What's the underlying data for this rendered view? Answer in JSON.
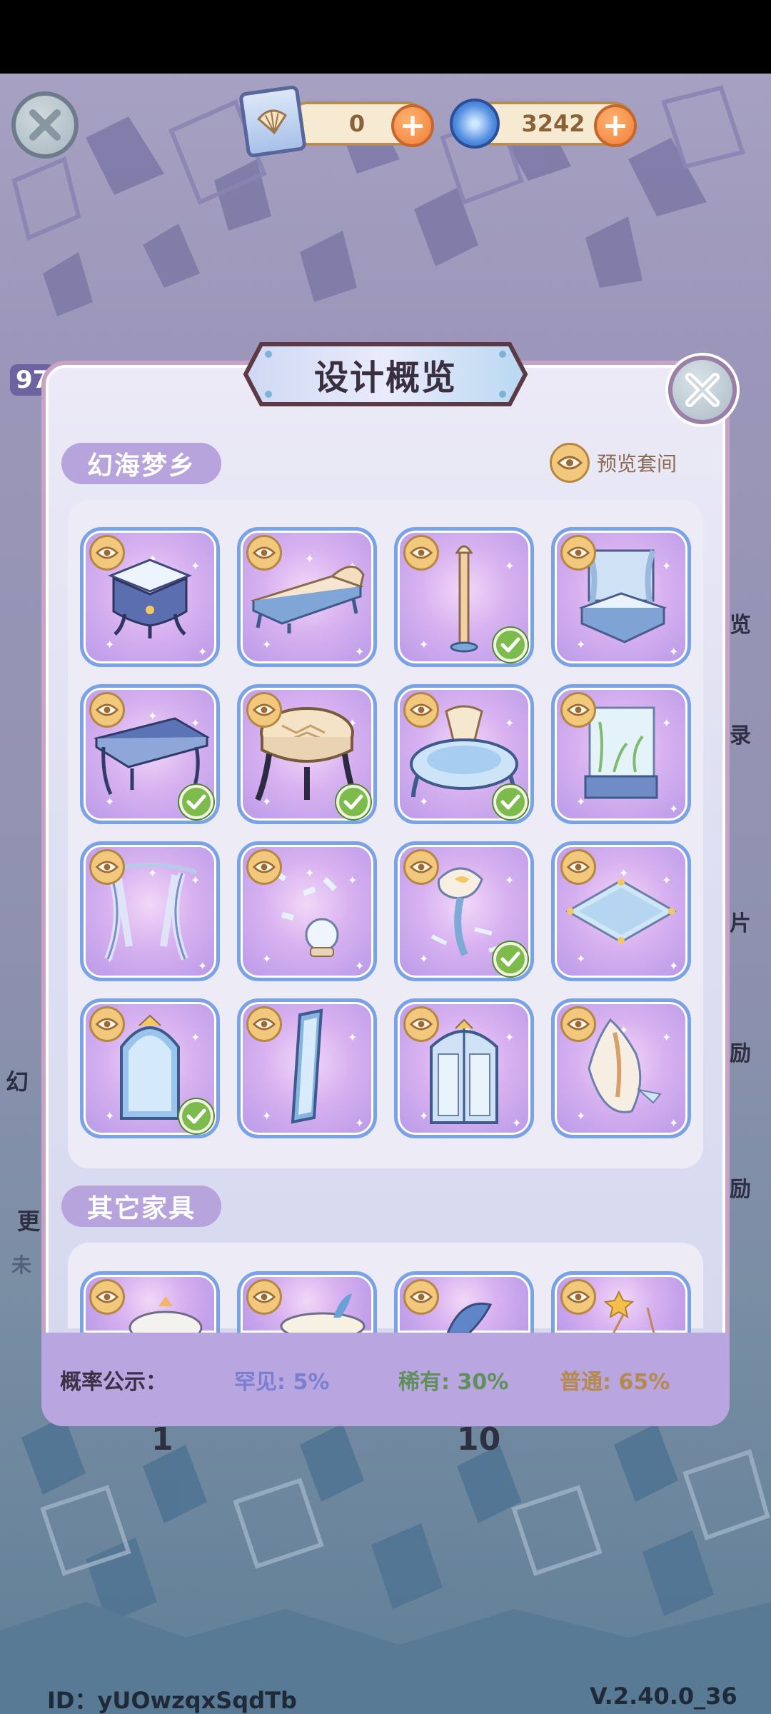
{
  "hud": {
    "coupon_count": "0",
    "swirl_count": "3242",
    "plus": "+"
  },
  "behind": {
    "left_number": "97",
    "side_texts": [
      "览",
      "录",
      "片",
      "励",
      "励"
    ],
    "left_texts": [
      "幻",
      "更",
      "未"
    ],
    "button_counts": [
      "1",
      "10"
    ]
  },
  "panel": {
    "title": "设计概览",
    "section1": "幻海梦乡",
    "preview_suite": "预览套间",
    "section2": "其它家具",
    "items": [
      {
        "name": "vanity-cabinet",
        "owned": false
      },
      {
        "name": "chaise-lounge",
        "owned": false
      },
      {
        "name": "floor-lamp",
        "owned": true
      },
      {
        "name": "canopy-bed",
        "owned": false
      },
      {
        "name": "writing-desk",
        "owned": true
      },
      {
        "name": "tufted-stool",
        "owned": true
      },
      {
        "name": "shell-bathtub",
        "owned": true
      },
      {
        "name": "aquarium-cabinet",
        "owned": false
      },
      {
        "name": "curtain",
        "owned": false
      },
      {
        "name": "snow-globe",
        "owned": false
      },
      {
        "name": "conch-lamp",
        "owned": true
      },
      {
        "name": "glass-rug",
        "owned": false
      },
      {
        "name": "arched-mirror",
        "owned": true
      },
      {
        "name": "tall-mirror",
        "owned": false
      },
      {
        "name": "double-door",
        "owned": false
      },
      {
        "name": "conch-sculpture",
        "owned": false
      }
    ]
  },
  "probability": {
    "label": "概率公示：",
    "rare": "罕见: 5%",
    "uncommon": "稀有: 30%",
    "common": "普通: 65%",
    "colors": {
      "rare": "#7b7fd0",
      "uncommon": "#5f8f5a",
      "common": "#b58a4f"
    }
  },
  "footer": {
    "id": "ID：yUOwzqxSqdTb",
    "version": "V.2.40.0_36"
  }
}
